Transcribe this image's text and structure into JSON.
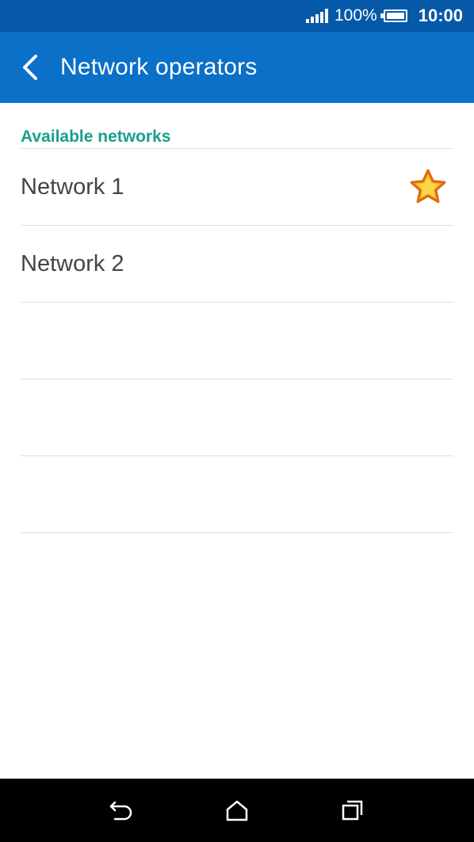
{
  "status_bar": {
    "battery_percent": "100%",
    "time": "10:00",
    "signal_icon": "signal-bars-icon",
    "battery_icon": "battery-full-icon"
  },
  "app_bar": {
    "title": "Network operators",
    "back_icon": "chevron-left-icon"
  },
  "section": {
    "header": "Available networks"
  },
  "networks": [
    {
      "label": "Network 1",
      "preferred": true,
      "icon": "star-icon"
    },
    {
      "label": "Network 2",
      "preferred": false
    }
  ],
  "navigation": {
    "back_icon": "back-arrow-icon",
    "home_icon": "home-icon",
    "recents_icon": "recent-apps-icon"
  },
  "colors": {
    "status_bar": "#0559a8",
    "app_bar": "#0a70c8",
    "section_header": "#199f8b",
    "star_fill": "#f7b21a",
    "star_outline": "#e06a10"
  }
}
